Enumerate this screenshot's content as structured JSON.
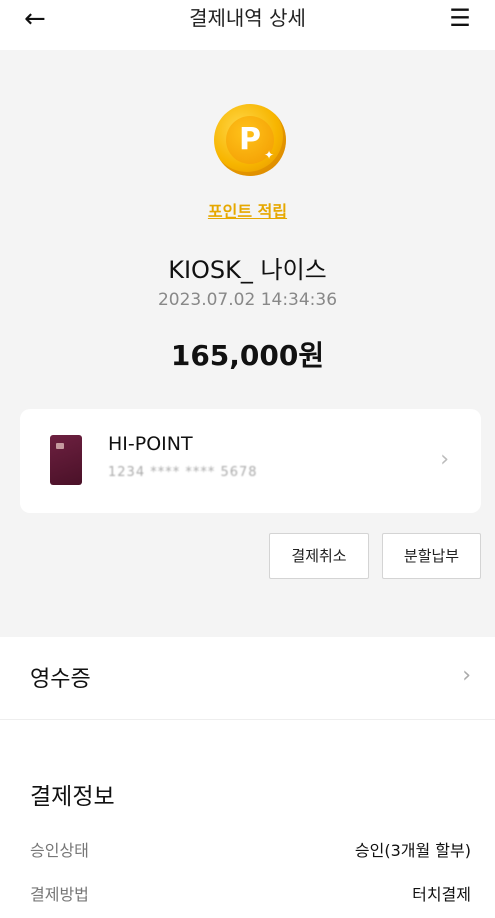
{
  "header": {
    "title": "결제내역 상세",
    "back_icon": "←",
    "menu_icon": "☰"
  },
  "summary": {
    "points_link": "포인트 적립",
    "merchant": "KIOSK_ 나이스",
    "datetime": "2023.07.02 14:34:36",
    "amount": "165,000원",
    "coin_letter": "P"
  },
  "card": {
    "name": "HI-POINT",
    "number_masked": "1234 **** **** 5678",
    "chevron": "›"
  },
  "actions": {
    "cancel_label": "결제취소",
    "installment_label": "분할납부"
  },
  "receipt": {
    "label": "영수증",
    "chevron": "›"
  },
  "payment_info": {
    "title": "결제정보",
    "rows": [
      {
        "label": "승인상태",
        "value": "승인(3개월 할부)"
      },
      {
        "label": "결제방법",
        "value": "터치결제"
      }
    ]
  },
  "colors": {
    "accent": "#e6a800",
    "background_gray": "#f4f4f4",
    "card_color": "#5a1533"
  }
}
